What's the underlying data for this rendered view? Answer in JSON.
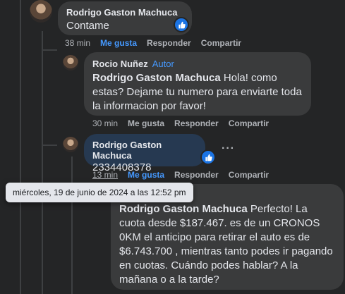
{
  "comment1": {
    "author": "Rodrigo Gaston Machuca",
    "text": "Contame",
    "time": "38 min",
    "like": "Me gusta",
    "reply": "Responder",
    "share": "Compartir"
  },
  "comment2": {
    "author": "Rocio Nuñez",
    "badge": "Autor",
    "mention": "Rodrigo Gaston Machuca",
    "text": " Hola! como estas? Dejame tu numero para enviarte toda la informacion por favor!",
    "time": "30 min",
    "like": "Me gusta",
    "reply": "Responder",
    "share": "Compartir"
  },
  "comment3": {
    "author": "Rodrigo Gaston Machuca",
    "text": "2334408378",
    "time": "13 min",
    "like": "Me gusta",
    "reply": "Responder",
    "share": "Compartir"
  },
  "comment4": {
    "mention": "Rodrigo Gaston Machuca",
    "text": " Perfecto! La cuota desde $187.467. es de un CRONOS 0KM el anticipo para retirar el auto es de $6.743.700 , mientras tanto podes ir pagando en cuotas. Cuándo podes hablar? A la mañana o a la tarde?"
  },
  "tooltip": "miércoles, 19 de junio de 2024 a las 12:52 pm",
  "colors": {
    "accent": "#4599ff",
    "bubble": "#3a3b3c",
    "highlight": "#263951"
  }
}
